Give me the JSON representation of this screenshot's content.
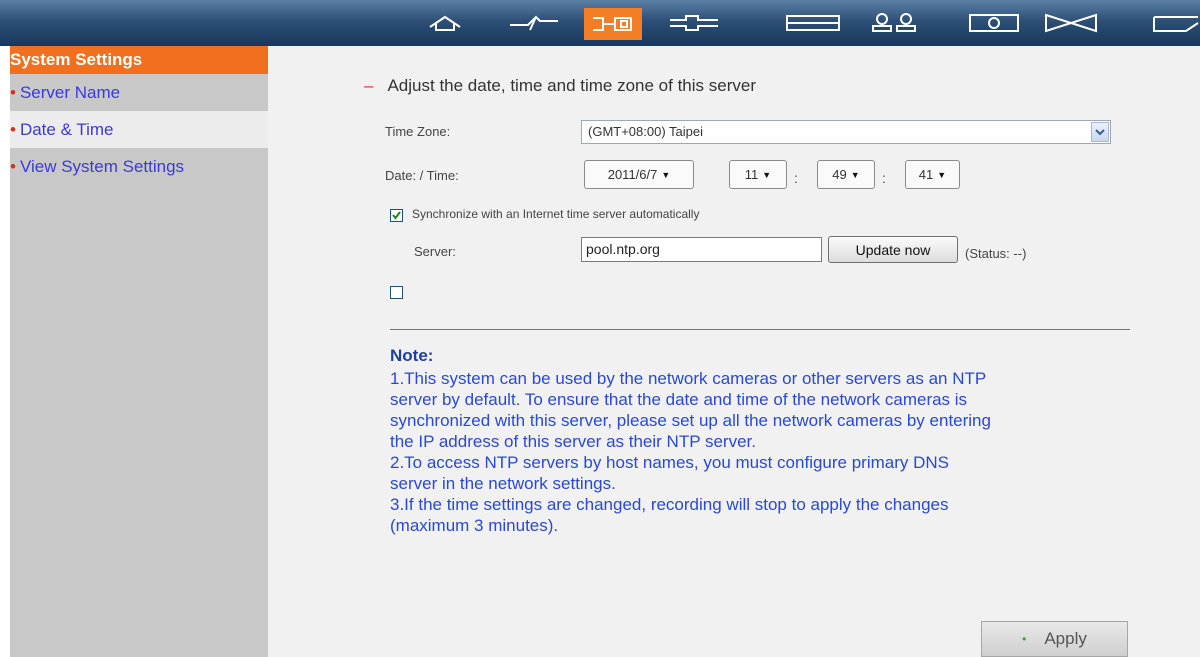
{
  "nav": {
    "icons": [
      "home-icon",
      "quick-config-icon",
      "system-settings-icon",
      "network-icon",
      "recording-icon",
      "user-management-icon",
      "device-icon",
      "logout-icon",
      "more-icon"
    ],
    "active": "system-settings-icon",
    "accent_color": "#f47e26"
  },
  "sidebar": {
    "title": "System Settings",
    "bullet": "•",
    "items": [
      {
        "label": "Server Name"
      },
      {
        "label": "Date & Time"
      },
      {
        "label": "View System Settings"
      }
    ],
    "selected_index": 1
  },
  "main": {
    "section_dash": "–",
    "section_title": "Adjust the date, time and time zone of this server",
    "time_zone_label": "Time Zone:",
    "time_zone_value": "(GMT+08:00) Taipei",
    "date_time_label": "Date: / Time:",
    "date_value": "2011/6/7",
    "hour_value": "11",
    "minute_value": "49",
    "second_value": "41",
    "colon": ":",
    "sync_checked": true,
    "sync_label": "Synchronize with an Internet time server automatically",
    "server_label": "Server:",
    "server_value": "pool.ntp.org",
    "update_button": "Update now",
    "status_text": "(Status: --)",
    "second_checkbox_checked": false,
    "note_title": "Note:",
    "note_lines": [
      "1.This system can be used by the network cameras or other servers as an NTP",
      "server by default. To ensure that the date and time of the network cameras is",
      "synchronized with this server, please set up all the network cameras by entering",
      "the IP address of this server as their NTP server.",
      "2.To access NTP servers by host names, you must configure primary DNS",
      "server in the network settings.",
      "3.If the time settings are changed, recording will stop to apply the changes",
      "(maximum 3 minutes)."
    ],
    "apply_button": "Apply",
    "apply_dot": "•"
  }
}
